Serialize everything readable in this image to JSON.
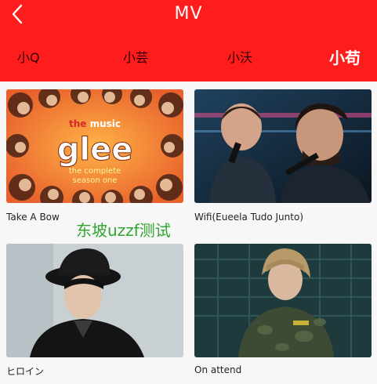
{
  "header": {
    "title": "MV",
    "background": "#ff1c1c",
    "back_icon": "chevron-left-icon"
  },
  "tabs": [
    {
      "label": "小Q",
      "active": false
    },
    {
      "label": "小芸",
      "active": false
    },
    {
      "label": "小沃",
      "active": false
    },
    {
      "label": "小苟",
      "active": true
    }
  ],
  "videos": [
    {
      "title": "Take A Bow",
      "poster": {
        "line1": "the music",
        "line2": "glee",
        "line3": "the complete",
        "line4": "season one"
      }
    },
    {
      "title": "Wifi(Eueela Tudo Junto)"
    },
    {
      "title": "ヒロイン"
    },
    {
      "title": "On attend"
    }
  ],
  "watermark": "东坡uzzf测试"
}
